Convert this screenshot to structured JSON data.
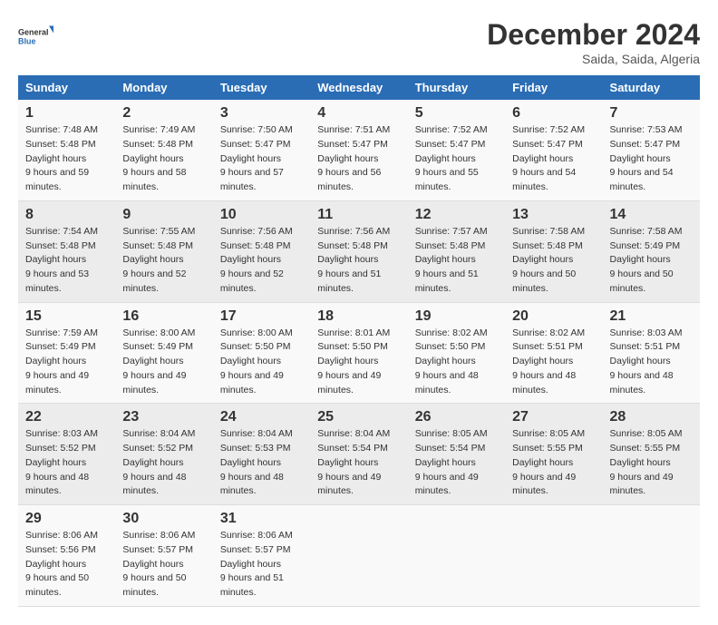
{
  "logo": {
    "line1": "General",
    "line2": "Blue"
  },
  "title": "December 2024",
  "subtitle": "Saida, Saida, Algeria",
  "weekdays": [
    "Sunday",
    "Monday",
    "Tuesday",
    "Wednesday",
    "Thursday",
    "Friday",
    "Saturday"
  ],
  "weeks": [
    [
      {
        "day": "1",
        "sunrise": "7:48 AM",
        "sunset": "5:48 PM",
        "daylight": "9 hours and 59 minutes."
      },
      {
        "day": "2",
        "sunrise": "7:49 AM",
        "sunset": "5:48 PM",
        "daylight": "9 hours and 58 minutes."
      },
      {
        "day": "3",
        "sunrise": "7:50 AM",
        "sunset": "5:47 PM",
        "daylight": "9 hours and 57 minutes."
      },
      {
        "day": "4",
        "sunrise": "7:51 AM",
        "sunset": "5:47 PM",
        "daylight": "9 hours and 56 minutes."
      },
      {
        "day": "5",
        "sunrise": "7:52 AM",
        "sunset": "5:47 PM",
        "daylight": "9 hours and 55 minutes."
      },
      {
        "day": "6",
        "sunrise": "7:52 AM",
        "sunset": "5:47 PM",
        "daylight": "9 hours and 54 minutes."
      },
      {
        "day": "7",
        "sunrise": "7:53 AM",
        "sunset": "5:47 PM",
        "daylight": "9 hours and 54 minutes."
      }
    ],
    [
      {
        "day": "8",
        "sunrise": "7:54 AM",
        "sunset": "5:48 PM",
        "daylight": "9 hours and 53 minutes."
      },
      {
        "day": "9",
        "sunrise": "7:55 AM",
        "sunset": "5:48 PM",
        "daylight": "9 hours and 52 minutes."
      },
      {
        "day": "10",
        "sunrise": "7:56 AM",
        "sunset": "5:48 PM",
        "daylight": "9 hours and 52 minutes."
      },
      {
        "day": "11",
        "sunrise": "7:56 AM",
        "sunset": "5:48 PM",
        "daylight": "9 hours and 51 minutes."
      },
      {
        "day": "12",
        "sunrise": "7:57 AM",
        "sunset": "5:48 PM",
        "daylight": "9 hours and 51 minutes."
      },
      {
        "day": "13",
        "sunrise": "7:58 AM",
        "sunset": "5:48 PM",
        "daylight": "9 hours and 50 minutes."
      },
      {
        "day": "14",
        "sunrise": "7:58 AM",
        "sunset": "5:49 PM",
        "daylight": "9 hours and 50 minutes."
      }
    ],
    [
      {
        "day": "15",
        "sunrise": "7:59 AM",
        "sunset": "5:49 PM",
        "daylight": "9 hours and 49 minutes."
      },
      {
        "day": "16",
        "sunrise": "8:00 AM",
        "sunset": "5:49 PM",
        "daylight": "9 hours and 49 minutes."
      },
      {
        "day": "17",
        "sunrise": "8:00 AM",
        "sunset": "5:50 PM",
        "daylight": "9 hours and 49 minutes."
      },
      {
        "day": "18",
        "sunrise": "8:01 AM",
        "sunset": "5:50 PM",
        "daylight": "9 hours and 49 minutes."
      },
      {
        "day": "19",
        "sunrise": "8:02 AM",
        "sunset": "5:50 PM",
        "daylight": "9 hours and 48 minutes."
      },
      {
        "day": "20",
        "sunrise": "8:02 AM",
        "sunset": "5:51 PM",
        "daylight": "9 hours and 48 minutes."
      },
      {
        "day": "21",
        "sunrise": "8:03 AM",
        "sunset": "5:51 PM",
        "daylight": "9 hours and 48 minutes."
      }
    ],
    [
      {
        "day": "22",
        "sunrise": "8:03 AM",
        "sunset": "5:52 PM",
        "daylight": "9 hours and 48 minutes."
      },
      {
        "day": "23",
        "sunrise": "8:04 AM",
        "sunset": "5:52 PM",
        "daylight": "9 hours and 48 minutes."
      },
      {
        "day": "24",
        "sunrise": "8:04 AM",
        "sunset": "5:53 PM",
        "daylight": "9 hours and 48 minutes."
      },
      {
        "day": "25",
        "sunrise": "8:04 AM",
        "sunset": "5:54 PM",
        "daylight": "9 hours and 49 minutes."
      },
      {
        "day": "26",
        "sunrise": "8:05 AM",
        "sunset": "5:54 PM",
        "daylight": "9 hours and 49 minutes."
      },
      {
        "day": "27",
        "sunrise": "8:05 AM",
        "sunset": "5:55 PM",
        "daylight": "9 hours and 49 minutes."
      },
      {
        "day": "28",
        "sunrise": "8:05 AM",
        "sunset": "5:55 PM",
        "daylight": "9 hours and 49 minutes."
      }
    ],
    [
      {
        "day": "29",
        "sunrise": "8:06 AM",
        "sunset": "5:56 PM",
        "daylight": "9 hours and 50 minutes."
      },
      {
        "day": "30",
        "sunrise": "8:06 AM",
        "sunset": "5:57 PM",
        "daylight": "9 hours and 50 minutes."
      },
      {
        "day": "31",
        "sunrise": "8:06 AM",
        "sunset": "5:57 PM",
        "daylight": "9 hours and 51 minutes."
      },
      {
        "day": "",
        "sunrise": "",
        "sunset": "",
        "daylight": ""
      },
      {
        "day": "",
        "sunrise": "",
        "sunset": "",
        "daylight": ""
      },
      {
        "day": "",
        "sunrise": "",
        "sunset": "",
        "daylight": ""
      },
      {
        "day": "",
        "sunrise": "",
        "sunset": "",
        "daylight": ""
      }
    ]
  ],
  "labels": {
    "sunrise": "Sunrise:",
    "sunset": "Sunset:",
    "daylight": "Daylight hours"
  }
}
